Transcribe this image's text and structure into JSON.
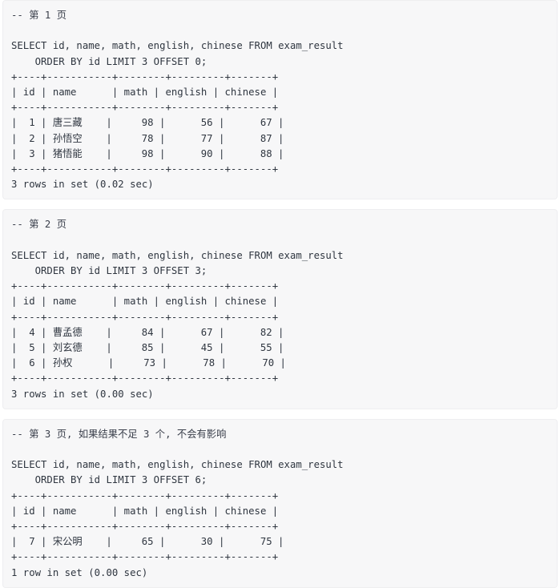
{
  "document": {
    "type": "sql-console-transcript",
    "background_color": "#ffffff",
    "block_background_color": "#f7f7f8",
    "text_color": "#2f3640"
  },
  "table": {
    "name": "exam_result",
    "columns": [
      "id",
      "name",
      "math",
      "english",
      "chinese"
    ]
  },
  "blocks": [
    {
      "id": "page-1",
      "comment": "-- 第 1 页",
      "sql_line_1": "SELECT id, name, math, english, chinese FROM exam_result",
      "sql_line_2": "    ORDER BY id LIMIT 3 OFFSET 0;",
      "limit": 3,
      "offset": 0,
      "separator": "+----+-----------+--------+---------+-------+",
      "header_row": "| id | name      | math | english | chinese |",
      "rows": [
        {
          "id": "1",
          "name": "唐三藏",
          "math": "98",
          "english": "56",
          "chinese": "67"
        },
        {
          "id": "2",
          "name": "孙悟空",
          "math": "78",
          "english": "77",
          "chinese": "87"
        },
        {
          "id": "3",
          "name": "猪悟能",
          "math": "98",
          "english": "90",
          "chinese": "88"
        }
      ],
      "status": "3 rows in set (0.02 sec)"
    },
    {
      "id": "page-2",
      "comment": "-- 第 2 页",
      "sql_line_1": "SELECT id, name, math, english, chinese FROM exam_result",
      "sql_line_2": "    ORDER BY id LIMIT 3 OFFSET 3;",
      "limit": 3,
      "offset": 3,
      "separator": "+----+-----------+--------+---------+-------+",
      "header_row": "| id | name      | math | english | chinese |",
      "rows": [
        {
          "id": "4",
          "name": "曹孟德",
          "math": "84",
          "english": "67",
          "chinese": "82"
        },
        {
          "id": "5",
          "name": "刘玄德",
          "math": "85",
          "english": "45",
          "chinese": "55"
        },
        {
          "id": "6",
          "name": "孙权",
          "math": "73",
          "english": "78",
          "chinese": "70"
        }
      ],
      "status": "3 rows in set (0.00 sec)"
    },
    {
      "id": "page-3",
      "comment": "-- 第 3 页, 如果结果不足 3 个, 不会有影响",
      "sql_line_1": "SELECT id, name, math, english, chinese FROM exam_result",
      "sql_line_2": "    ORDER BY id LIMIT 3 OFFSET 6;",
      "limit": 3,
      "offset": 6,
      "separator": "+----+-----------+--------+---------+-------+",
      "header_row": "| id | name      | math | english | chinese |",
      "rows": [
        {
          "id": "7",
          "name": "宋公明",
          "math": "65",
          "english": "30",
          "chinese": "75"
        }
      ],
      "status": "1 row in set (0.00 sec)"
    }
  ]
}
